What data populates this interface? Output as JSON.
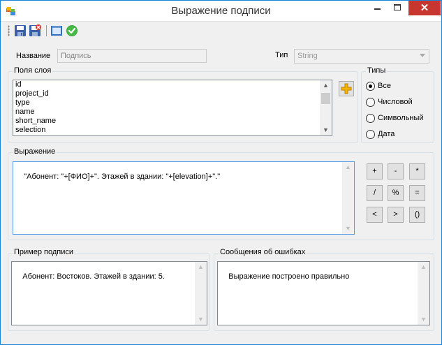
{
  "window": {
    "title": "Выражение подписи"
  },
  "toolbar": {
    "icons": [
      "save-icon",
      "save-close-icon",
      "window-icon",
      "apply-check-icon"
    ]
  },
  "form": {
    "name_label": "Название",
    "name_placeholder": "Подпись",
    "type_label": "Тип",
    "type_value": "String"
  },
  "layer_fields": {
    "title": "Поля слоя",
    "items": [
      "id",
      "project_id",
      "type",
      "name",
      "short_name",
      "selection"
    ]
  },
  "types": {
    "title": "Типы",
    "options": [
      {
        "label": "Все",
        "selected": true
      },
      {
        "label": "Числовой",
        "selected": false
      },
      {
        "label": "Символьный",
        "selected": false
      },
      {
        "label": "Дата",
        "selected": false
      }
    ]
  },
  "expression": {
    "title": "Выражение",
    "value": "\"Абонент: \"+[ФИО]+\". Этажей в здании: \"+[elevation]+\".\""
  },
  "operators": [
    "+",
    "-",
    "*",
    "/",
    "%",
    "=",
    "<",
    ">",
    "()"
  ],
  "preview": {
    "title": "Пример подписи",
    "value": "Абонент: Востоков. Этажей в здании: 5."
  },
  "errors": {
    "title": "Сообщения об ошибках",
    "value": "Выражение построено правильно"
  },
  "colors": {
    "accent": "#1883d7",
    "close": "#c7372f",
    "window_bg": "#f0f0f0"
  }
}
